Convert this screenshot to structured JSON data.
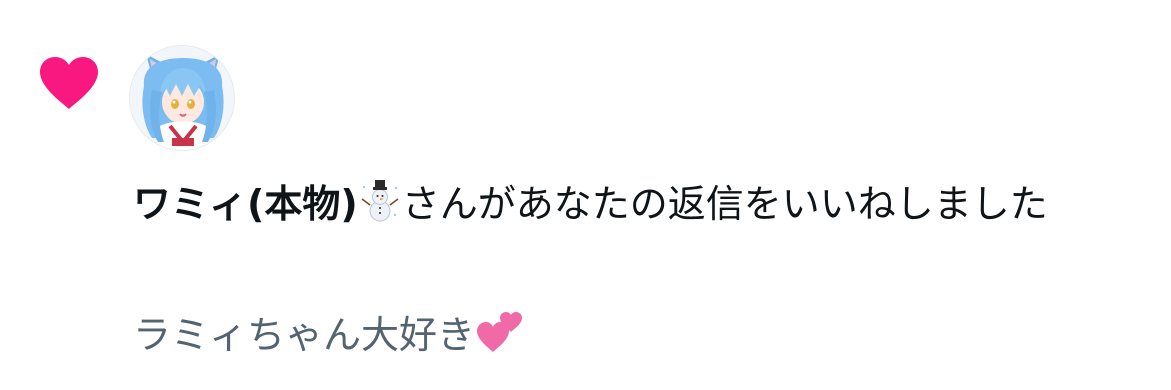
{
  "notification": {
    "type_icon": "heart-icon",
    "accent_color": "#f91880",
    "avatar_icon": "avatar-anime-blue-hair",
    "user_name": "ワミィ(本物)",
    "user_emoji": "snowman-icon",
    "action_text": "さんがあなたの返信をいいねしました",
    "tweet_text": "ラミィちゃん大好き",
    "tweet_emoji": "two-hearts-icon",
    "text_color": "#0f1419",
    "secondary_text_color": "#536471"
  }
}
